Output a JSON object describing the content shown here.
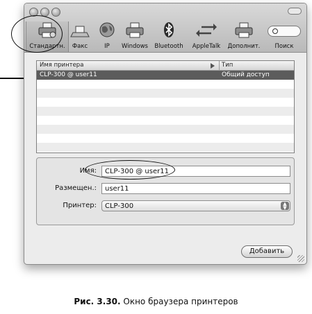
{
  "toolbar": {
    "items": [
      {
        "label": "Стандартн.",
        "icon": "printer-icon",
        "selected": true
      },
      {
        "label": "Факс",
        "icon": "fax-icon"
      },
      {
        "label": "IP",
        "icon": "globe-icon"
      },
      {
        "label": "Windows",
        "icon": "printer-icon"
      },
      {
        "label": "Bluetooth",
        "icon": "bluetooth-icon"
      },
      {
        "label": "AppleTalk",
        "icon": "appletalk-arrows-icon"
      },
      {
        "label": "Дополнит.",
        "icon": "printer-icon"
      },
      {
        "label": "Поиск",
        "icon": "search-icon"
      }
    ]
  },
  "printer_list": {
    "columns": [
      "Имя принтера",
      "Тип"
    ],
    "rows": [
      {
        "name": "CLP-300 @ user11",
        "type": "Общий доступ",
        "selected": true
      }
    ]
  },
  "form": {
    "name_label": "Имя:",
    "name_value": "CLP-300 @ user11",
    "location_label": "Размещен.:",
    "location_value": "user11",
    "printer_label": "Принтер:",
    "printer_value": "CLP-300"
  },
  "add_button": "Добавить",
  "caption": {
    "prefix": "Рис. 3.30.",
    "text": " Окно браузера принтеров"
  }
}
